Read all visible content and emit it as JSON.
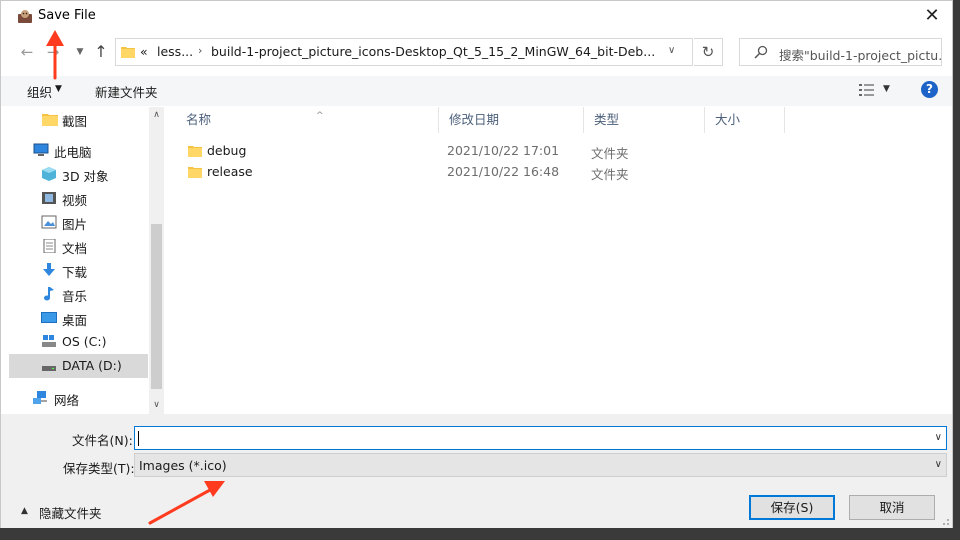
{
  "window": {
    "title": "Save File"
  },
  "address": {
    "crumbs": [
      "«",
      "less...",
      "build-1-project_picture_icons-Desktop_Qt_5_15_2_MinGW_64_bit-Deb..."
    ]
  },
  "search": {
    "placeholder": "搜索\"build-1-project_pictu..."
  },
  "toolbar": {
    "organize": "组织",
    "new_folder": "新建文件夹"
  },
  "sidebar": {
    "items": [
      {
        "label": "截图",
        "icon": "folder-icon"
      },
      {
        "label": "此电脑",
        "icon": "computer-icon"
      },
      {
        "label": "3D 对象",
        "icon": "cube-icon"
      },
      {
        "label": "视频",
        "icon": "video-icon"
      },
      {
        "label": "图片",
        "icon": "picture-icon"
      },
      {
        "label": "文档",
        "icon": "document-icon"
      },
      {
        "label": "下载",
        "icon": "download-icon"
      },
      {
        "label": "音乐",
        "icon": "music-icon"
      },
      {
        "label": "桌面",
        "icon": "desktop-icon"
      },
      {
        "label": "OS (C:)",
        "icon": "drive-c-icon"
      },
      {
        "label": "DATA (D:)",
        "icon": "drive-d-icon"
      },
      {
        "label": "网络",
        "icon": "network-icon"
      }
    ]
  },
  "filelist": {
    "columns": [
      "名称",
      "修改日期",
      "类型",
      "大小"
    ],
    "rows": [
      {
        "name": "debug",
        "modified": "2021/10/22 17:01",
        "type": "文件夹",
        "size": ""
      },
      {
        "name": "release",
        "modified": "2021/10/22 16:48",
        "type": "文件夹",
        "size": ""
      }
    ]
  },
  "form": {
    "filename_label": "文件名(N):",
    "filename_value": "",
    "filetype_label": "保存类型(T):",
    "filetype_value": "Images (*.ico)"
  },
  "footer": {
    "hide_folders": "隐藏文件夹",
    "save": "保存(S)",
    "cancel": "取消"
  },
  "colors": {
    "accent": "#0078d7",
    "folder": "#f5c342",
    "annotation": "#ff3b1f"
  }
}
